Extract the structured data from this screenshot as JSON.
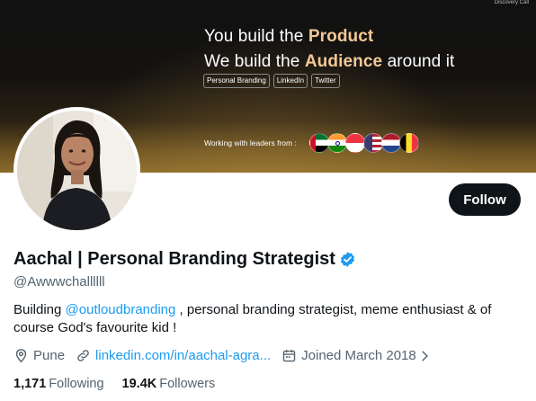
{
  "banner": {
    "line1_prefix": "You build the ",
    "line1_highlight": "Product",
    "line2_prefix": "We build the ",
    "line2_highlight": "Audience",
    "line2_suffix": " around it",
    "tags": [
      "Personal Branding",
      "LinkedIn",
      "Twitter"
    ],
    "working_with": "Working with leaders from :",
    "flags": [
      "uae-flag-icon",
      "india-flag-icon",
      "singapore-flag-icon",
      "usa-flag-icon",
      "netherlands-flag-icon",
      "belgium-flag-icon"
    ],
    "corner_text": [
      "",
      "Discovery Call"
    ]
  },
  "profile": {
    "follow_label": "Follow",
    "name": "Aachal | Personal Branding Strategist",
    "handle": "@Awwwchallllll",
    "bio_prefix": "Building ",
    "bio_mention": "@outloudbranding",
    "bio_suffix": " , personal branding strategist, meme enthusiast & of course God's favourite kid !",
    "location": "Pune",
    "website": "linkedin.com/in/aachal-agra...",
    "joined": "Joined March 2018",
    "following_count": "1,171",
    "following_label": "Following",
    "followers_count": "19.4K",
    "followers_label": "Followers"
  },
  "colors": {
    "accent": "#1d9bf0",
    "text_primary": "#0f1419",
    "text_secondary": "#536471",
    "banner_highlight": "#f2c896"
  }
}
